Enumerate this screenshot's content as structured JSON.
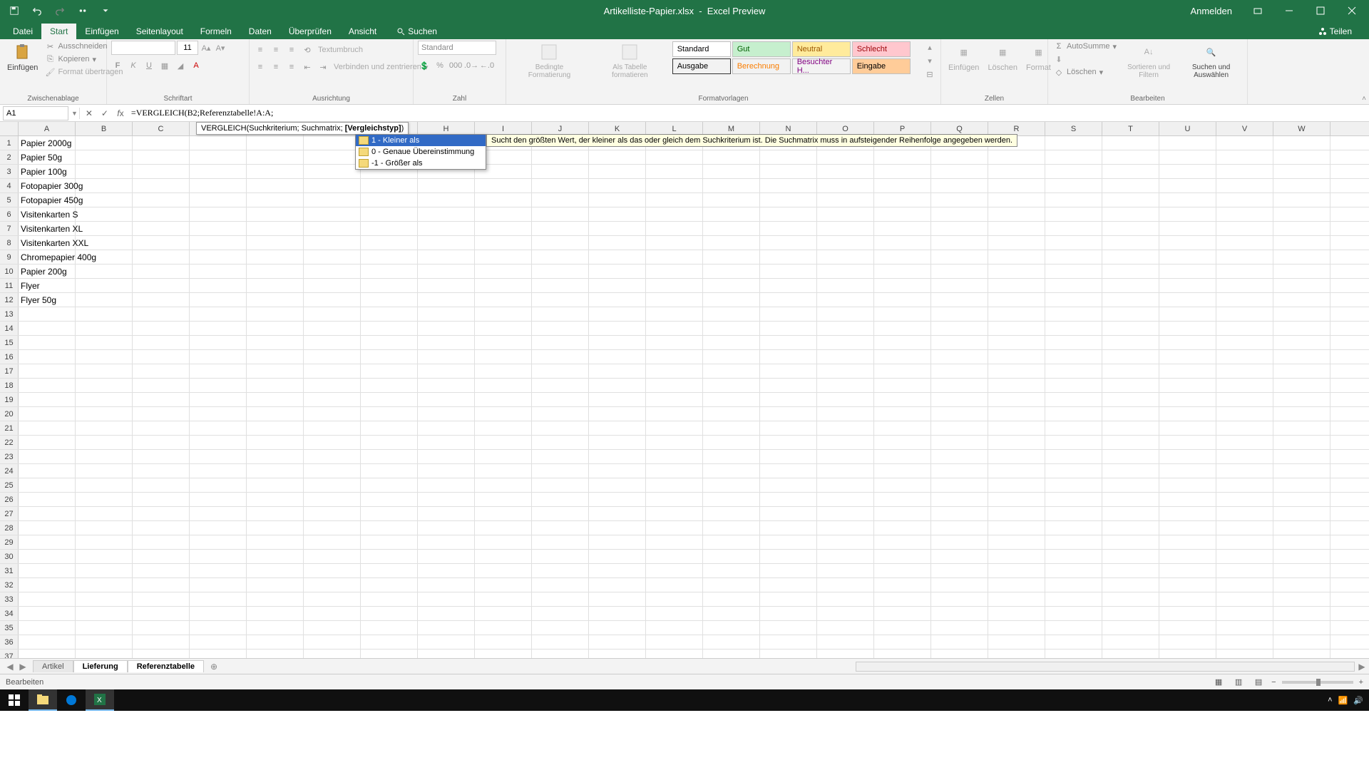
{
  "titlebar": {
    "filename": "Artikelliste-Papier.xlsx",
    "app": "Excel Preview",
    "signin": "Anmelden"
  },
  "tabs": {
    "file": "Datei",
    "home": "Start",
    "insert": "Einfügen",
    "pagelayout": "Seitenlayout",
    "formulas": "Formeln",
    "data": "Daten",
    "review": "Überprüfen",
    "view": "Ansicht",
    "search": "Suchen",
    "share": "Teilen"
  },
  "ribbon": {
    "clipboard": {
      "label": "Zwischenablage",
      "paste": "Einfügen",
      "cut": "Ausschneiden",
      "copy": "Kopieren",
      "format_painter": "Format übertragen"
    },
    "font": {
      "label": "Schriftart",
      "size": "11"
    },
    "alignment": {
      "label": "Ausrichtung",
      "wrap": "Textumbruch",
      "merge": "Verbinden und zentrieren"
    },
    "number": {
      "label": "Zahl",
      "format": "Standard"
    },
    "styles": {
      "label": "Formatvorlagen",
      "conditional": "Bedingte Formatierung",
      "as_table": "Als Tabelle formatieren",
      "standard": "Standard",
      "gut": "Gut",
      "neutral": "Neutral",
      "schlecht": "Schlecht",
      "ausgabe": "Ausgabe",
      "berechnung": "Berechnung",
      "besuchter": "Besuchter H...",
      "eingabe": "Eingabe"
    },
    "cells": {
      "label": "Zellen",
      "insert": "Einfügen",
      "delete": "Löschen",
      "format": "Format"
    },
    "editing": {
      "label": "Bearbeiten",
      "autosum": "AutoSumme",
      "fill": "",
      "clear": "Löschen",
      "sort": "Sortieren und Filtern",
      "find": "Suchen und Auswählen"
    }
  },
  "formula_bar": {
    "name_box": "A1",
    "formula": "=VERGLEICH(B2;Referenztabelle!A:A;"
  },
  "tooltip": {
    "func_sig_pre": "VERGLEICH(Suchkriterium; Suchmatrix; ",
    "func_sig_bold": "[Vergleichstyp]",
    "func_sig_post": ")"
  },
  "autocomplete": {
    "opt1": "1 - Kleiner als",
    "opt2": "0 - Genaue Übereinstimmung",
    "opt3": "-1 - Größer als",
    "desc": "Sucht den größten Wert, der kleiner als das oder gleich dem Suchkriterium ist. Die Suchmatrix muss in aufsteigender Reihenfolge angegeben werden."
  },
  "columns": [
    "A",
    "B",
    "C",
    "D",
    "E",
    "F",
    "G",
    "H",
    "I",
    "J",
    "K",
    "L",
    "M",
    "N",
    "O",
    "P",
    "Q",
    "R",
    "S",
    "T",
    "U",
    "V",
    "W"
  ],
  "cells": {
    "a1": "Papier 2000g",
    "a2": "Papier 50g",
    "a3": "Papier 100g",
    "a4": "Fotopapier 300g",
    "a5": "Fotopapier 450g",
    "a6": "Visitenkarten S",
    "a7": "Visitenkarten XL",
    "a8": "Visitenkarten XXL",
    "a9": "Chromepapier 400g",
    "a10": "Papier 200g",
    "a11": "Flyer",
    "a12": "Flyer 50g"
  },
  "sheets": {
    "s1": "Artikel",
    "s2": "Lieferung",
    "s3": "Referenztabelle"
  },
  "status": {
    "mode": "Bearbeiten"
  }
}
